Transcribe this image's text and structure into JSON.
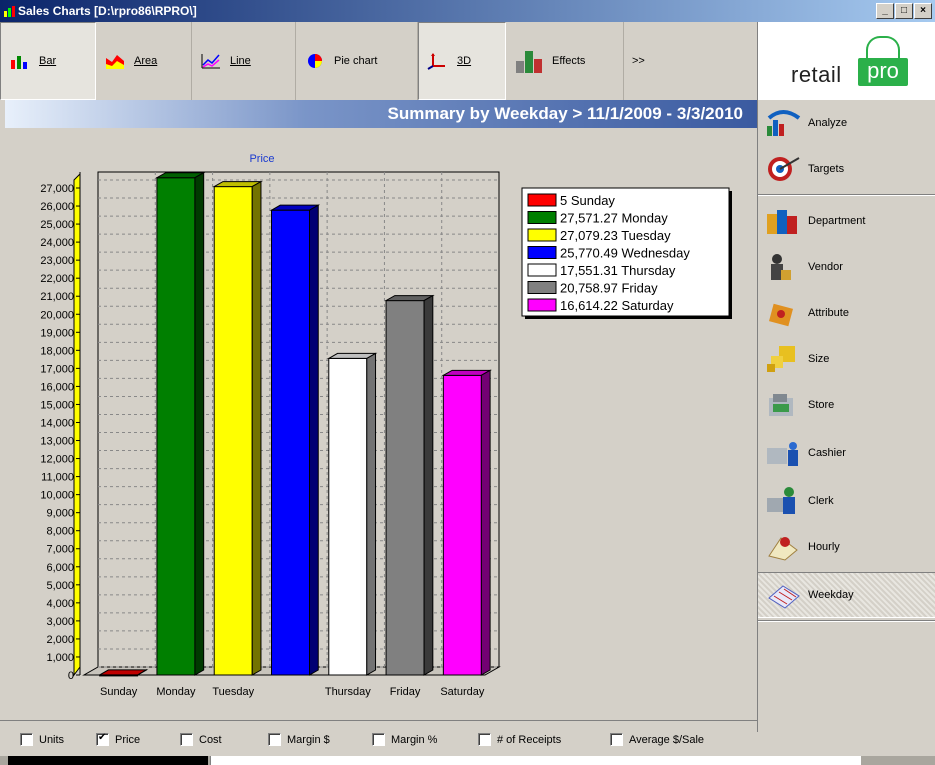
{
  "window": {
    "title": "Sales Charts [D:\\rpro86\\RPRO\\]",
    "minimize": "_",
    "maximize": "□",
    "close": "×"
  },
  "toolbar": {
    "bar": "Bar",
    "area": "Area",
    "line": "Line",
    "pie": "Pie chart",
    "d3": "3D",
    "effects": "Effects",
    "more": ">>"
  },
  "logo": {
    "retail": "retail",
    "pro": "pro"
  },
  "chart_header": "Summary by Weekday > 11/1/2009 - 3/3/2010",
  "chart_data": {
    "type": "bar",
    "title": "Price",
    "categories": [
      "Sunday",
      "Monday",
      "Tuesday",
      "Wednesday",
      "Thursday",
      "Friday",
      "Saturday"
    ],
    "values": [
      5,
      27571.27,
      27079.23,
      25770.49,
      17551.31,
      20758.97,
      16614.22
    ],
    "colors": [
      "#ff0000",
      "#007f00",
      "#ffff00",
      "#0000ff",
      "#ffffff",
      "#808080",
      "#ff00ff"
    ],
    "ylim": [
      0,
      27000
    ],
    "ytick_step": 1000,
    "y_ticks": [
      "0",
      "1,000",
      "2,000",
      "3,000",
      "4,000",
      "5,000",
      "6,000",
      "7,000",
      "8,000",
      "9,000",
      "10,000",
      "11,000",
      "12,000",
      "13,000",
      "14,000",
      "15,000",
      "16,000",
      "17,000",
      "18,000",
      "19,000",
      "20,000",
      "21,000",
      "22,000",
      "23,000",
      "24,000",
      "25,000",
      "26,000",
      "27,000"
    ],
    "x_tick_labels": [
      "Sunday",
      "Monday",
      "Tuesday",
      "",
      "Thursday",
      "Friday",
      "Saturday"
    ],
    "legend": [
      "5 Sunday",
      "27,571.27 Monday",
      "27,079.23 Tuesday",
      "25,770.49 Wednesday",
      "17,551.31 Thursday",
      "20,758.97 Friday",
      "16,614.22 Saturday"
    ],
    "legend_position": "top-right",
    "grid": true,
    "three_d": true
  },
  "sidebar": {
    "items": [
      {
        "label": "Analyze",
        "icon": "analyze-icon"
      },
      {
        "label": "Targets",
        "icon": "targets-icon"
      },
      {
        "label": "Department",
        "icon": "department-icon"
      },
      {
        "label": "Vendor",
        "icon": "vendor-icon"
      },
      {
        "label": "Attribute",
        "icon": "attribute-icon"
      },
      {
        "label": "Size",
        "icon": "size-icon"
      },
      {
        "label": "Store",
        "icon": "store-icon"
      },
      {
        "label": "Cashier",
        "icon": "cashier-icon"
      },
      {
        "label": "Clerk",
        "icon": "clerk-icon"
      },
      {
        "label": "Hourly",
        "icon": "hourly-icon"
      },
      {
        "label": "Weekday",
        "icon": "weekday-icon"
      }
    ]
  },
  "checkboxes": [
    {
      "label": "Units",
      "checked": false
    },
    {
      "label": "Price",
      "checked": true
    },
    {
      "label": "Cost",
      "checked": false
    },
    {
      "label": "Margin $",
      "checked": false
    },
    {
      "label": "Margin %",
      "checked": false
    },
    {
      "label": "# of Receipts",
      "checked": false
    },
    {
      "label": "Average $/Sale",
      "checked": false
    }
  ]
}
